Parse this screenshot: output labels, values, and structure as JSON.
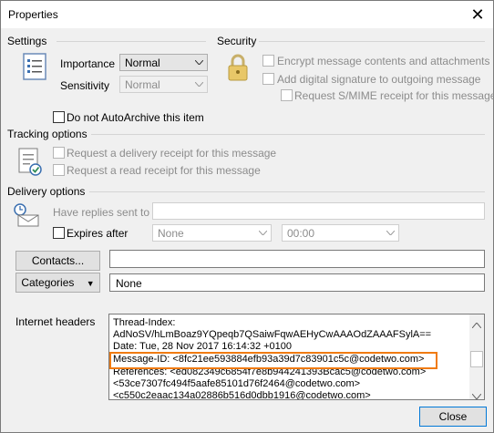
{
  "window": {
    "title": "Properties"
  },
  "settings": {
    "header": "Settings",
    "importance_label": "Importance",
    "importance_value": "Normal",
    "sensitivity_label": "Sensitivity",
    "sensitivity_value": "Normal",
    "autoarchive_label": "Do not AutoArchive this item"
  },
  "security": {
    "header": "Security",
    "encrypt_label": "Encrypt message contents and attachments",
    "signature_label": "Add digital signature to outgoing message",
    "smime_label": "Request S/MIME receipt for this message"
  },
  "tracking": {
    "header": "Tracking options",
    "delivery_receipt_label": "Request a delivery receipt for this message",
    "read_receipt_label": "Request a read receipt for this message"
  },
  "delivery": {
    "header": "Delivery options",
    "replies_label": "Have replies sent to",
    "expires_label": "Expires after",
    "expires_date": "None",
    "expires_time": "00:00"
  },
  "contacts_button": "Contacts...",
  "categories_button": "Categories",
  "categories_value": "None",
  "internet_headers": {
    "label": "Internet headers",
    "lines": [
      "Thread-Index:",
      "AdNoSV/hLmBoaz9YQpeqb7QSaiwFqwAEHyCwAAAOdZAAAFSylA==",
      "Date: Tue, 28 Nov 2017 16:14:32 +0100",
      "Message-ID: <8fc21ee593884efb93a39d7c83901c5c@codetwo.com>",
      "References: <ed082349c6854f7e8b944241393Bcac5@codetwo.com>",
      " <53ce7307fc494f5aafe85101d76f2464@codetwo.com>",
      " <c550c2eaac134a02886b516d0dbb1916@codetwo.com>"
    ]
  },
  "close_button": "Close",
  "colors": {
    "highlight": "#f07b11",
    "primary_border": "#0078d7"
  }
}
